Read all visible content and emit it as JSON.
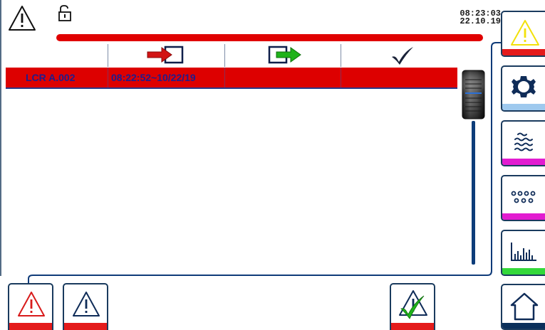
{
  "header": {
    "time": "08:23:03",
    "date": "22.10.19",
    "alarm_bar_color": "#e00000"
  },
  "table": {
    "columns": [
      {
        "icon": "alarm-in-icon"
      },
      {
        "icon": "alarm-out-icon"
      },
      {
        "icon": "checkmark-icon"
      }
    ],
    "rows": [
      {
        "source": "LCR A.002",
        "time_range": "08:22:52~10/22/19",
        "status_color": "#dd0000"
      }
    ]
  },
  "sidebar": {
    "items": [
      {
        "icon": "warning-icon",
        "accent": "#e41b1b"
      },
      {
        "icon": "gear-icon",
        "accent": "#9ec9ee"
      },
      {
        "icon": "waves-icon",
        "accent": "#e21cd0"
      },
      {
        "icon": "dots-icon",
        "accent": "#e21cd0"
      },
      {
        "icon": "bar-chart-icon",
        "accent": "#34d83a"
      },
      {
        "icon": "home-icon",
        "accent": "#0a2f5a"
      }
    ]
  },
  "bottom": {
    "items": [
      {
        "icon": "warning-red-icon",
        "accent": "#e41b1b"
      },
      {
        "icon": "warning-icon",
        "accent": "#e41b1b"
      },
      {
        "icon": "acknowledge-icon",
        "accent": "#e41b1b"
      }
    ]
  }
}
